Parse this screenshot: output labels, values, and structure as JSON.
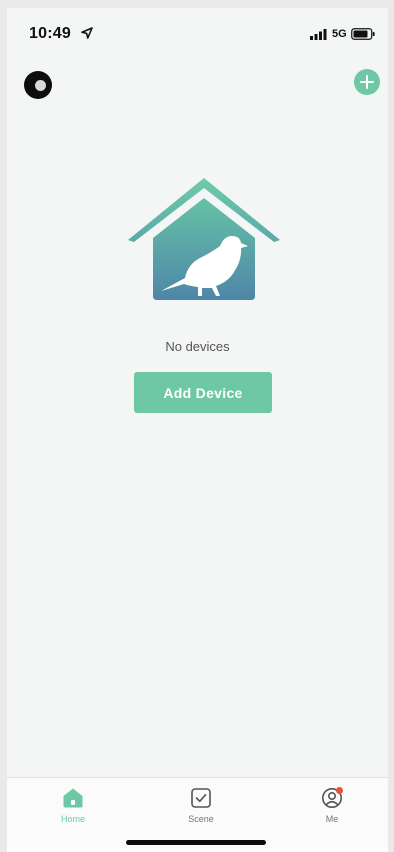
{
  "status_bar": {
    "time": "10:49",
    "location_icon": "location-arrow-icon",
    "signal_icon": "signal-bars-icon",
    "network": "5G",
    "battery_icon": "battery-icon"
  },
  "header": {
    "avatar_icon": "avatar",
    "add_icon": "plus-icon"
  },
  "empty_state": {
    "illustration": "bird-house-icon",
    "message": "No devices",
    "button_label": "Add Device"
  },
  "tab_bar": {
    "tabs": [
      {
        "label": "Home",
        "icon": "home-icon",
        "active": true
      },
      {
        "label": "Scene",
        "icon": "checkbox-icon",
        "active": false
      },
      {
        "label": "Me",
        "icon": "profile-icon",
        "active": false,
        "badge": true
      }
    ]
  },
  "colors": {
    "accent": "#6ec8a6",
    "background": "#f4f5f5",
    "badge": "#e8503c"
  }
}
